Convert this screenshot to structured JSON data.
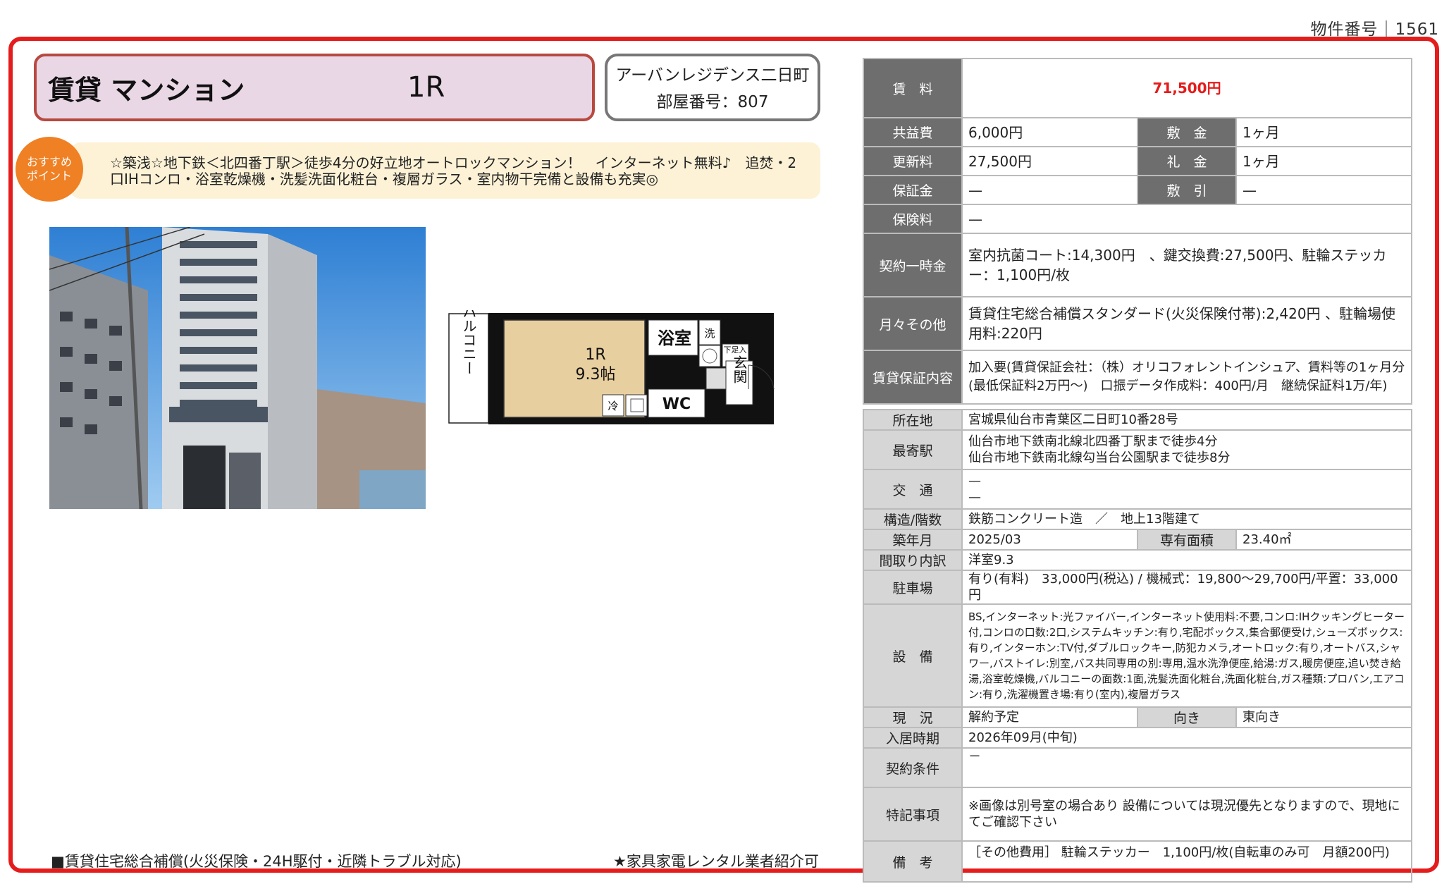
{
  "property_number": "物件番号｜1561",
  "header": {
    "type": "賃貸 マンション",
    "layout": "1R",
    "building_name": "アーバンレジデンス二日町",
    "room_number": "部屋番号：807"
  },
  "recommend": {
    "badge_line1": "おすすめ",
    "badge_line2": "ポイント",
    "text": "☆築浅☆地下鉄＜北四番丁駅＞徒歩4分の好立地オートロックマンション！　インターネット無料♪　追焚・2口IHコンロ・浴室乾燥機・洗髪洗面化粧台・複層ガラス・室内物干完備と設備も充実◎"
  },
  "floorplan": {
    "balcony": "バルコニー",
    "room": "1R",
    "room_size": "9.3帖",
    "bath": "浴室",
    "wash": "洗",
    "shoes": "下足入",
    "entrance": "玄関",
    "wc": "WC",
    "fridge": "冷"
  },
  "costs": {
    "rent_label": "賃　料",
    "rent": "71,500円",
    "common_label": "共益費",
    "common": "6,000円",
    "deposit_label": "敷　金",
    "deposit": "1ヶ月",
    "renewal_label": "更新料",
    "renewal": "27,500円",
    "key_money_label": "礼　金",
    "key_money": "1ヶ月",
    "guarantee_label": "保証金",
    "guarantee": "—",
    "amortize_label": "敷　引",
    "amortize": "—",
    "insurance_label": "保険料",
    "insurance": "—",
    "onetime_label": "契約一時金",
    "onetime": "室内抗菌コート:14,300円　、鍵交換費:27,500円、駐輪ステッカー：1,100円/枚",
    "monthly_label": "月々その他",
    "monthly": "賃貸住宅総合補償スタンダード(火災保険付帯):2,420円 、駐輪場使用料:220円",
    "guarantor_label": "賃貸保証内容",
    "guarantor": "加入要(賃貸保証会社：（株）オリコフォレントインシュア、賃料等の1ヶ月分(最低保証料2万円～)　口振データ作成料：400円/月　継続保証料1万/年)"
  },
  "details": {
    "address_label": "所在地",
    "address": "宮城県仙台市青葉区二日町10番28号",
    "station_label": "最寄駅",
    "station1": "仙台市地下鉄南北線北四番丁駅まで徒歩4分",
    "station2": "仙台市地下鉄南北線勾当台公園駅まで徒歩8分",
    "traffic_label": "交　通",
    "traffic1": "—",
    "traffic2": "—",
    "structure_label": "構造/階数",
    "structure": "鉄筋コンクリート造　／　地上13階建て",
    "built_label": "築年月",
    "built": "2025/03",
    "area_label": "専有面積",
    "area": "23.40㎡",
    "rooms_label": "間取り内訳",
    "rooms": "洋室9.3",
    "parking_label": "駐車場",
    "parking": "有り(有料)　33,000円(税込) / 機械式：19,800～29,700円/平置：33,000円",
    "equipment_label": "設　備",
    "equipment": "BS,インターネット:光ファイバー,インターネット使用料:不要,コンロ:IHクッキングヒーター付,コンロの口数:2口,システムキッチン:有り,宅配ボックス,集合郵便受け,シューズボックス:有り,インターホン:TV付,ダブルロックキー,防犯カメラ,オートロック:有り,オートバス,シャワー,バストイレ:別室,バス共同専用の別:専用,温水洗浄便座,給湯:ガス,暖房便座,追い焚き給湯,浴室乾燥機,バルコニーの面数:1面,洗髪洗面化粧台,洗面化粧台,ガス種類:プロパン,エアコン:有り,洗濯機置き場:有り(室内),複層ガラス",
    "status_label": "現　況",
    "status": "解約予定",
    "direction_label": "向き",
    "direction": "東向き",
    "move_in_label": "入居時期",
    "move_in": "2026年09月(中旬)",
    "conditions_label": "契約条件",
    "conditions": "－",
    "notes_label": "特記事項",
    "notes": "※画像は別号室の場合あり 設備については現況優先となりますので、現地にてご確認下さい",
    "remarks_label": "備　考",
    "remarks": "［その他費用］ 駐輪ステッカー　1,100円/枚(自転車のみ可　月額200円)"
  },
  "footer": {
    "left": "■賃貸住宅総合補償(火災保険・24H駆付・近隣トラブル対応)",
    "right": "★家具家電レンタル業者紹介可"
  },
  "colors": {
    "frame": "#e51c1c",
    "rent": "#e51c1c",
    "type_box": "#e9d7e6",
    "badge": "#ef8024",
    "recommend_bg": "#fdf2d6",
    "header_cell": "#6e6e6e",
    "label_cell": "#d6d6d6"
  }
}
